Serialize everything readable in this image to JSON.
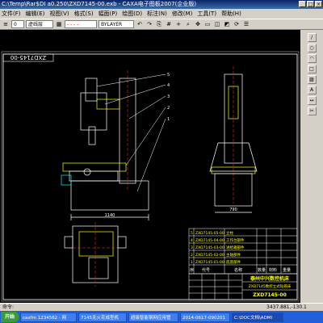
{
  "window": {
    "title": "C:\\Temp\\Rar$DI a0.250\\ZXD7145-00.exb - CAXA电子图板2007(企业版)",
    "controls": [
      "_",
      "□",
      "×"
    ]
  },
  "menu": {
    "items": [
      "文件(F)",
      "编辑(E)",
      "视图(V)",
      "格式(S)",
      "幅面(P)",
      "绘图(D)",
      "标注(N)",
      "修改(M)",
      "工具(T)",
      "帮助(H)"
    ]
  },
  "toolbar": {
    "layer_value": "0",
    "linetype_value": "虚线层",
    "color_value": "BYLAYER"
  },
  "drawing": {
    "title_block_code_rotated": "ZXD7145-00",
    "dim_bottom_left": "1140",
    "dim_right_bottom": "790",
    "balloons": [
      "1",
      "2",
      "3",
      "4",
      "5"
    ],
    "parts_list": [
      {
        "no": "5",
        "code": "ZXD7145-05-00",
        "name": "立柱"
      },
      {
        "no": "4",
        "code": "ZXD7145-04-00",
        "name": "工作台部件"
      },
      {
        "no": "3",
        "code": "ZXD7145-03-00",
        "name": "进给箱部件"
      },
      {
        "no": "2",
        "code": "ZXD7145-02-00",
        "name": "主轴部件"
      },
      {
        "no": "1",
        "code": "ZXD7145-01-00",
        "name": "底座部件"
      }
    ],
    "parts_header": {
      "no": "序",
      "code": "代号",
      "name": "名称",
      "qty": "数量",
      "material": "材料",
      "weight": "重量",
      "remark": "备注"
    },
    "company": "泰州中兴数控机床",
    "product": "ZXD7145数控立式钻铣床",
    "drawing_no": "ZXD7145-00"
  },
  "status": {
    "command": "命令:",
    "coords": "3437.881,-130.1"
  },
  "taskbar": {
    "start": "开始",
    "tasks": [
      "caxfm 1234562 - 网",
      "7145无火花成型机",
      "超级智能钢网应用管",
      "2014-0617-090201",
      "C:\\DOC文档\\ADMI"
    ],
    "active_index": 4
  },
  "colors": {
    "canvas_bg": "#000000",
    "line_white": "#ffffff",
    "line_yellow": "#ffff00",
    "line_red": "#ff3030",
    "line_cyan": "#00ffff",
    "line_green": "#00ff00"
  }
}
